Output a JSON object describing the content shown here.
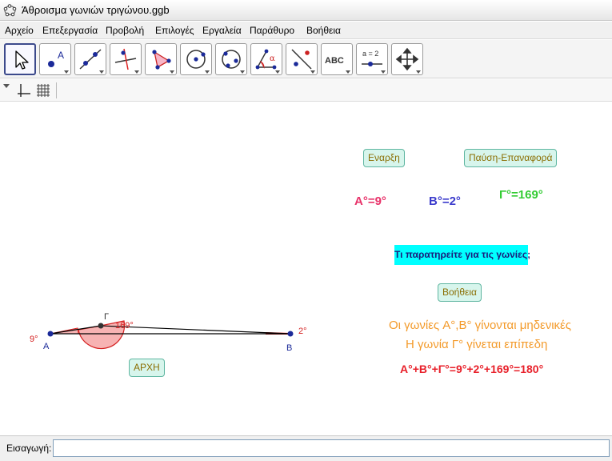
{
  "window": {
    "title": "Άθροισμα γωνιών τριγώνου.ggb"
  },
  "menu": [
    "Αρχείο",
    "Επεξεργασία",
    "Προβολή",
    "Επιλογές",
    "Εργαλεία",
    "Παράθυρο",
    "Βοήθεια"
  ],
  "toolbar": {
    "tools": [
      {
        "icon": "move-arrow-icon",
        "selected": true
      },
      {
        "icon": "new-point-icon",
        "text": "A"
      },
      {
        "icon": "line-through-two-points-icon"
      },
      {
        "icon": "perpendicular-line-icon"
      },
      {
        "icon": "polygon-icon"
      },
      {
        "icon": "circle-center-point-icon"
      },
      {
        "icon": "circle-three-points-icon"
      },
      {
        "icon": "angle-icon",
        "text": "α"
      },
      {
        "icon": "reflect-about-line-icon"
      },
      {
        "icon": "insert-text-icon",
        "text": "ABC"
      },
      {
        "icon": "slider-icon",
        "text": "a = 2"
      },
      {
        "icon": "move-graphics-view-icon"
      }
    ]
  },
  "stylebar": {
    "icons": [
      "show-axes-icon",
      "show-grid-icon"
    ]
  },
  "canvas": {
    "buttons": {
      "start": "Εναρξη",
      "pause": "Παύση-Επαναφορά",
      "help": "Βοήθεια",
      "reset": "ΑΡΧΗ"
    },
    "angles": {
      "a": "A°=9°",
      "b": "B°=2°",
      "g": "Γ°=169°"
    },
    "question": "Τι παρατηρείτε για τις γωνίες;",
    "observation1": "Οι γωνίες A°,B° γίνονται μηδενικές",
    "observation2": "Η γωνία Γ° γίνεται επίπεδη",
    "sum": "A°+B°+Γ°=9°+2°+169°=180°",
    "points": {
      "a": "A",
      "b": "B",
      "g": "Γ"
    },
    "angle_labels": {
      "a": "9°",
      "b": "2°",
      "g": "169°"
    },
    "colors": {
      "angle_a": "#e8336a",
      "angle_b": "#3c3ccc",
      "angle_g": "#33cc33",
      "observation": "#f39a2a",
      "sum": "#e8202a",
      "question_bg": "#00ffff"
    }
  },
  "input": {
    "label": "Εισαγωγή:",
    "value": ""
  }
}
